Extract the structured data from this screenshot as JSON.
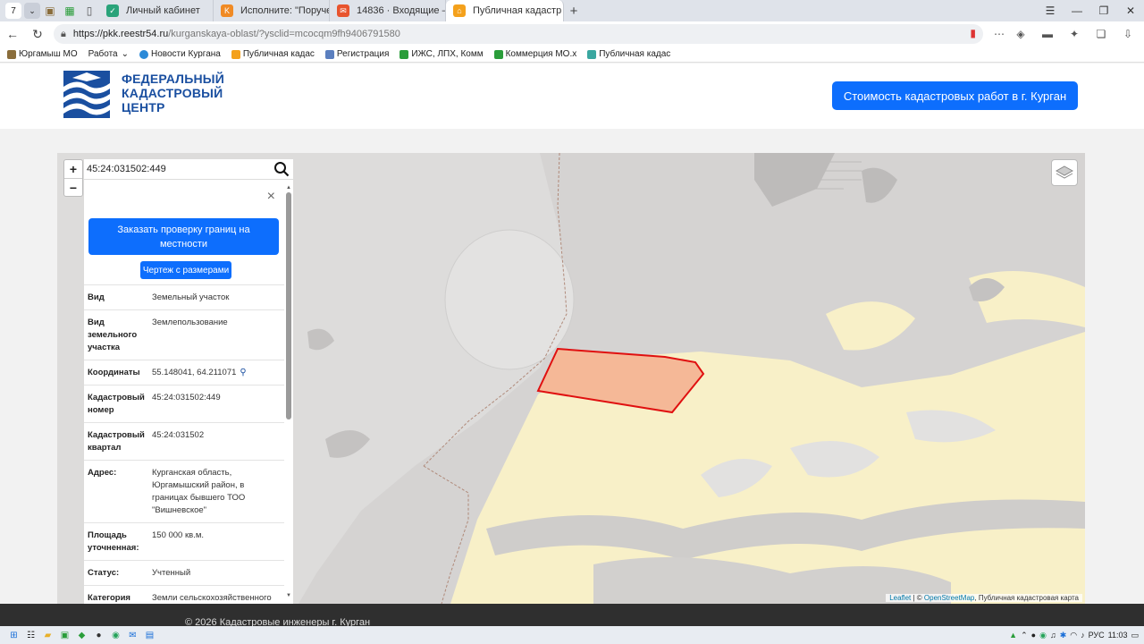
{
  "browser": {
    "tab_count": "7",
    "tabs": [
      {
        "title": "Личный кабинет",
        "active": false
      },
      {
        "title": "Исполните: \"Поручение: (",
        "active": false
      },
      {
        "title": "14836 · Входящие — Янде",
        "active": false
      },
      {
        "title": "Публичная кадастр",
        "active": true
      }
    ],
    "url_host": "https://pkk.reestr54.ru",
    "url_path": "/kurganskaya-oblast/?ysclid=mcocqm9fh9406791580"
  },
  "bookmarks": [
    "Юргамыш МО",
    "Работа",
    "Новости Кургана",
    "Публичная кадас",
    "Регистрация",
    "ИЖС, ЛПХ, Комм",
    "Коммерция МО.x",
    "Публичная кадас"
  ],
  "header": {
    "logo_line1": "ФЕДЕРАЛЬНЫЙ",
    "logo_line2": "КАДАСТРОВЫЙ",
    "logo_line3": "ЦЕНТР",
    "cta_label": "Стоимость кадастровых работ в г. Курган"
  },
  "map": {
    "search_value": "45:24:031502:449",
    "zoom_in": "+",
    "zoom_out": "−",
    "attribution_leaflet": "Leaflet",
    "attribution_sep": " | © ",
    "attribution_osm": "OpenStreetMap",
    "attribution_rest": ", Публичная кадастровая карта"
  },
  "panel": {
    "close": "×",
    "order_button": "Заказать проверку границ на местности",
    "drawing_button": "Чертеж с размерами",
    "rows": [
      {
        "key": "Вид",
        "value": "Земельный участок"
      },
      {
        "key": "Вид земельного участка",
        "value": "Землепользование"
      },
      {
        "key": "Координаты",
        "value": "55.148041, 64.211071"
      },
      {
        "key": "Кадастровый номер",
        "value": "45:24:031502:449"
      },
      {
        "key": "Кадастровый квартал",
        "value": "45:24:031502"
      },
      {
        "key": "Адрес:",
        "value": "Курганская область, Юргамышский район, в границах бывшего ТОО \"Вишневское\""
      },
      {
        "key": "Площадь уточненная:",
        "value": "150 000 кв.м."
      },
      {
        "key": "Статус:",
        "value": "Учтенный"
      },
      {
        "key": "Категория",
        "value": "Земли сельскохозяйственного"
      }
    ]
  },
  "footer": {
    "copyright": "© 2026 Кадастровые инженеры г. Курган"
  },
  "taskbar": {
    "lang": "РУС",
    "time": "11:03"
  },
  "colors": {
    "brand_blue": "#1a4fa0",
    "button_blue": "#0d6efd",
    "parcel_fill": "#f5b897",
    "parcel_stroke": "#e01010",
    "land_yellow": "#f8f0c8"
  }
}
